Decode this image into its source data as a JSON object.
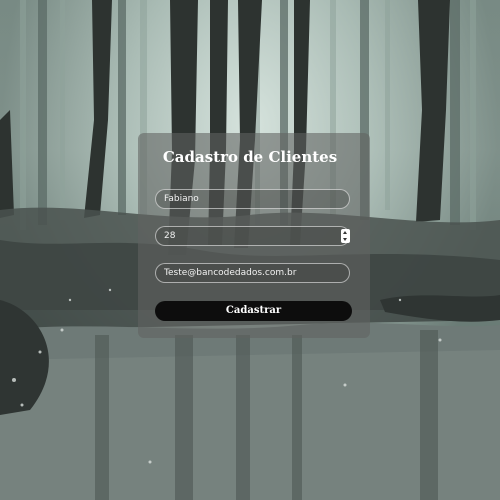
{
  "form": {
    "title": "Cadastro de Clientes",
    "name_value": "Fabiano",
    "age_value": "28",
    "email_value": "Teste@bancodedados.com.br",
    "submit_label": "Cadastrar"
  },
  "colors": {
    "card_background": "#606260",
    "button_background": "#0d0d0d",
    "text": "#ffffff"
  },
  "icons": {
    "age_field_spinner": "number-stepper"
  }
}
